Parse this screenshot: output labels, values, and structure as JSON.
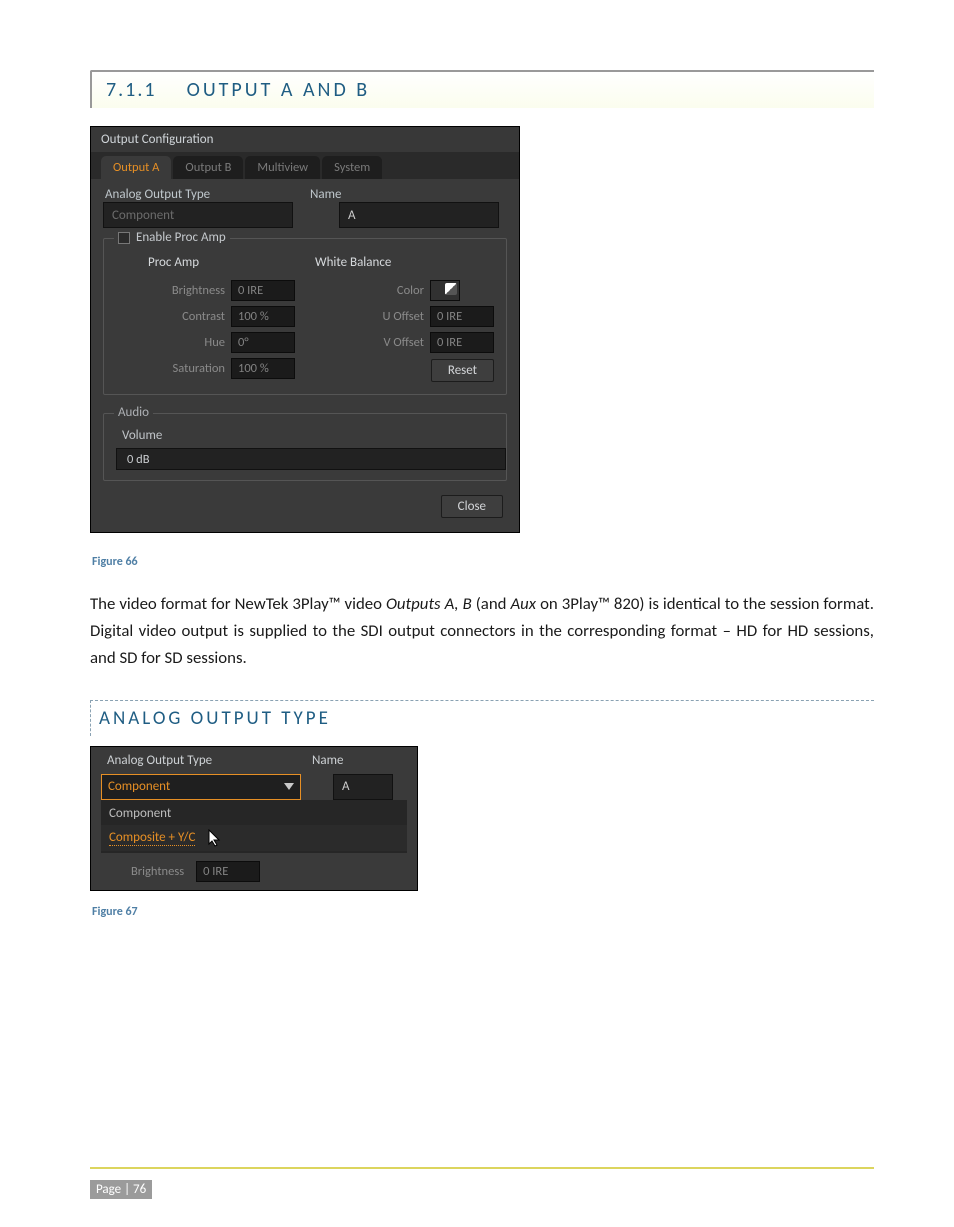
{
  "section": {
    "number": "7.1.1",
    "title": "OUTPUT A AND B"
  },
  "dialog": {
    "title": "Output Configuration",
    "tabs": [
      "Output A",
      "Output B",
      "Multiview",
      "System"
    ],
    "active_tab": 0,
    "header": {
      "type_label": "Analog Output Type",
      "name_label": "Name"
    },
    "type_value": "Component",
    "name_value": "A",
    "enable_proc_amp": "Enable Proc Amp",
    "proc_amp": {
      "col1_title": "Proc Amp",
      "rows": [
        {
          "label": "Brightness",
          "value": "0 IRE"
        },
        {
          "label": "Contrast",
          "value": "100 %"
        },
        {
          "label": "Hue",
          "value": "0°"
        },
        {
          "label": "Saturation",
          "value": "100 %"
        }
      ]
    },
    "white_balance": {
      "title": "White Balance",
      "color_label": "Color",
      "rows": [
        {
          "label": "U Offset",
          "value": "0 IRE"
        },
        {
          "label": "V Offset",
          "value": "0 IRE"
        }
      ]
    },
    "reset_label": "Reset",
    "audio": {
      "legend": "Audio",
      "volume_label": "Volume",
      "volume_value": "0 dB"
    },
    "close_label": "Close"
  },
  "caption1": "Figure 66",
  "paragraph": {
    "p1a": "The video format for NewTek 3Play™ video ",
    "p1b": "Outputs A, B",
    "p1c": " (and ",
    "p1d": "Aux",
    "p1e": " on 3Play™ 820) is identical to the session format.  Digital video output is supplied to the SDI output connectors in the corresponding format – HD for HD sessions, and SD for SD sessions."
  },
  "subheader": "ANALOG OUTPUT TYPE",
  "mini": {
    "type_label": "Analog Output Type",
    "name_label": "Name",
    "combo_value": "Component",
    "name_value": "A",
    "options": [
      "Component",
      "Composite + Y/C"
    ],
    "brightness_label": "Brightness",
    "brightness_value": "0 IRE"
  },
  "caption2": "Figure 67",
  "footer": {
    "page": "Page | 76"
  }
}
